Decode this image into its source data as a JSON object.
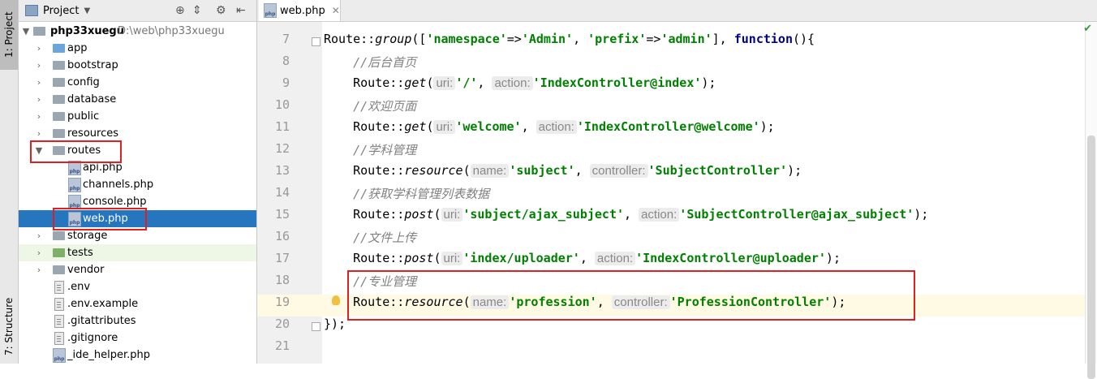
{
  "toolstrip": {
    "project_tab": "1: Project",
    "structure_tab": "7: Structure"
  },
  "project_panel": {
    "title": "Project",
    "root": {
      "name": "php33xuegu",
      "path": "D:\\web\\php33xuegu"
    },
    "items": [
      {
        "label": "app",
        "kind": "folder-blue"
      },
      {
        "label": "bootstrap",
        "kind": "folder"
      },
      {
        "label": "config",
        "kind": "folder"
      },
      {
        "label": "database",
        "kind": "folder"
      },
      {
        "label": "public",
        "kind": "folder"
      },
      {
        "label": "resources",
        "kind": "folder"
      },
      {
        "label": "routes",
        "kind": "folder",
        "expanded": true
      },
      {
        "label": "api.php",
        "kind": "php"
      },
      {
        "label": "channels.php",
        "kind": "php"
      },
      {
        "label": "console.php",
        "kind": "php"
      },
      {
        "label": "web.php",
        "kind": "php",
        "selected": true
      },
      {
        "label": "storage",
        "kind": "folder"
      },
      {
        "label": "tests",
        "kind": "folder-green"
      },
      {
        "label": "vendor",
        "kind": "folder"
      },
      {
        "label": ".env",
        "kind": "file"
      },
      {
        "label": ".env.example",
        "kind": "file"
      },
      {
        "label": ".gitattributes",
        "kind": "file"
      },
      {
        "label": ".gitignore",
        "kind": "file"
      },
      {
        "label": "_ide_helper.php",
        "kind": "php"
      }
    ]
  },
  "editor": {
    "tab_label": "web.php",
    "line_numbers": [
      "7",
      "8",
      "9",
      "10",
      "11",
      "12",
      "13",
      "14",
      "15",
      "16",
      "17",
      "18",
      "19",
      "20",
      "21"
    ],
    "tokens": {
      "route": "Route",
      "sep": "::",
      "group": "group",
      "get": "get",
      "resource": "resource",
      "post": "post",
      "namespace_key": "'namespace'",
      "arrow": "=>",
      "admin_ns": "'Admin'",
      "prefix_key": "'prefix'",
      "admin_prefix": "'admin'",
      "function_kw": "function",
      "c_home": "//后台首页",
      "c_welcome": "//欢迎页面",
      "c_subject": "//学科管理",
      "c_list": "//获取学科管理列表数据",
      "c_upload": "//文件上传",
      "c_profession": "//专业管理",
      "hint_uri": "uri:",
      "hint_action": "action:",
      "hint_name": "name:",
      "hint_controller": "controller:",
      "s_root": "'/'",
      "s_index": "'IndexController@index'",
      "s_welcome": "'welcome'",
      "s_index_welcome": "'IndexController@welcome'",
      "s_subject": "'subject'",
      "s_subject_ctrl": "'SubjectController'",
      "s_ajax_subject": "'subject/ajax_subject'",
      "s_subject_ajax": "'SubjectController@ajax_subject'",
      "s_upload": "'index/uploader'",
      "s_index_upload": "'IndexController@uploader'",
      "s_profession": "'profession'",
      "s_profession_ctrl": "'ProfessionController'",
      "close": "});"
    }
  }
}
